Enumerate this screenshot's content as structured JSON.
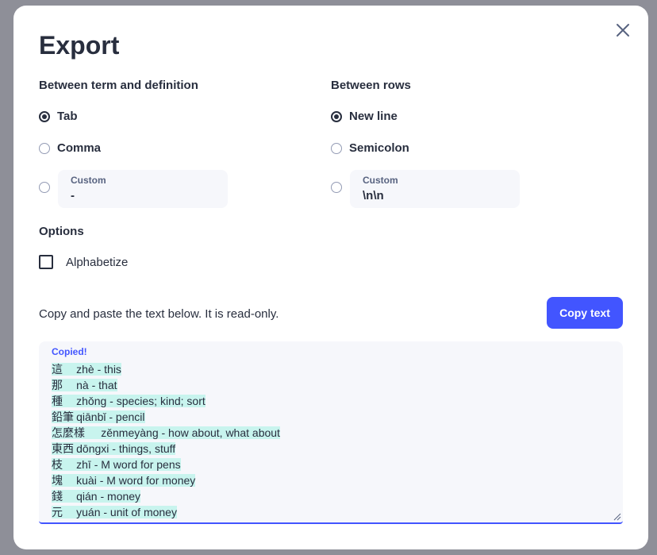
{
  "dialog": {
    "title": "Export",
    "close_icon": "close-icon"
  },
  "term_separator": {
    "label": "Between term and definition",
    "options": [
      "Tab",
      "Comma"
    ],
    "selected": "Tab",
    "custom_label": "Custom",
    "custom_value": "-"
  },
  "row_separator": {
    "label": "Between rows",
    "options": [
      "New line",
      "Semicolon"
    ],
    "selected": "New line",
    "custom_label": "Custom",
    "custom_value": "\\n\\n"
  },
  "options": {
    "label": "Options",
    "alphabetize_label": "Alphabetize",
    "alphabetize_checked": false
  },
  "output": {
    "help_text": "Copy and paste the text below. It is read-only.",
    "copy_button": "Copy text",
    "status": "Copied!",
    "lines": [
      "這\tzhè - this",
      "那\tnà - that",
      "種\tzhǒng - species; kind; sort",
      "鉛筆\tqiānbǐ - pencil",
      "怎麼樣\tzěnmeyàng - how about, what about",
      "東西\tdōngxi - things, stuff",
      "枝\tzhī - M word for pens",
      "塊\tkuài - M word for money",
      "錢\tqián - money",
      "元\tyuán - unit of money"
    ]
  },
  "colors": {
    "accent": "#4255ff",
    "highlight": "#c8f4ee",
    "text": "#282e3e",
    "field_bg": "#f6f7fb"
  }
}
